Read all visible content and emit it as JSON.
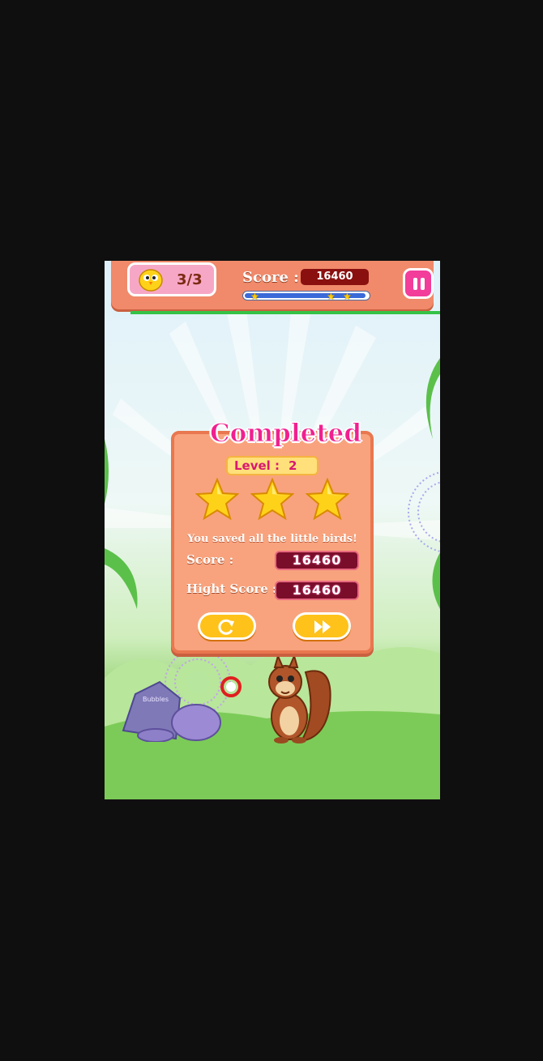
{
  "hud": {
    "birds_count": "3/3",
    "score_label": "Score :",
    "score_value": "16460",
    "progress_fraction": 0.98,
    "milestone_stars": 3
  },
  "dialog": {
    "title": "Completed",
    "level_label": "Level :",
    "level_value": "2",
    "stars_earned": 3,
    "message": "You saved all the little birds!",
    "score_label": "Score :",
    "score_value": "16460",
    "high_score_label": "Hight Score :",
    "high_score_value": "16460",
    "buttons": [
      "replay",
      "next"
    ]
  },
  "scene": {
    "rock_text": "Bubbles"
  },
  "colors": {
    "accent_pink": "#f0208f",
    "panel": "#f8a37d",
    "button_yellow": "#ffc21a",
    "score_box": "#8a1010"
  }
}
